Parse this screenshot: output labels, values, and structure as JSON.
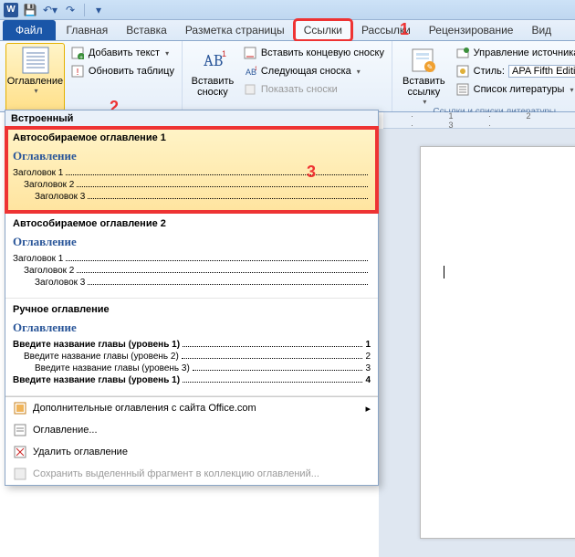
{
  "qat": {
    "save": "💾",
    "undo": "↶",
    "redo": "↷"
  },
  "tabs": {
    "file": "Файл",
    "home": "Главная",
    "insert": "Вставка",
    "pagelayout": "Разметка страницы",
    "references": "Ссылки",
    "mailings": "Рассылки",
    "review": "Рецензирование",
    "view": "Вид"
  },
  "ribbon": {
    "toc_big": "Оглавление",
    "add_text": "Добавить текст",
    "update_table": "Обновить таблицу",
    "insert_footnote_big": "Вставить\nсноску",
    "insert_endnote": "Вставить концевую сноску",
    "next_footnote": "Следующая сноска",
    "show_footnotes": "Показать сноски",
    "insert_link_big": "Вставить\nссылку",
    "manage_sources": "Управление источникам",
    "style_label": "Стиль:",
    "style_value": "APA Fifth Editi",
    "bibliography": "Список литературы",
    "group_cites": "Ссылки и списки литературы"
  },
  "numbers": {
    "n1": "1",
    "n2": "2",
    "n3": "3"
  },
  "gallery": {
    "builtin": "Встроенный",
    "auto1_title": "Автособираемое оглавление 1",
    "auto2_title": "Автособираемое оглавление 2",
    "manual_title": "Ручное оглавление",
    "toc_heading": "Оглавление",
    "h1": "Заголовок 1",
    "h2": "Заголовок 2",
    "h3": "Заголовок 3",
    "m1": "Введите название главы (уровень 1)",
    "m2": "Введите название главы (уровень 2)",
    "m3": "Введите название главы (уровень 3)",
    "m4": "Введите название главы (уровень 1)",
    "pg1": "1",
    "pg2": "2",
    "pg3": "3",
    "pg4": "4",
    "fo_office": "Дополнительные оглавления с сайта Office.com",
    "fo_custom": "Оглавление...",
    "fo_remove": "Удалить оглавление",
    "fo_save": "Сохранить выделенный фрагмент в коллекцию оглавлений..."
  },
  "ruler": "· 1 · 2 · 3 ·"
}
